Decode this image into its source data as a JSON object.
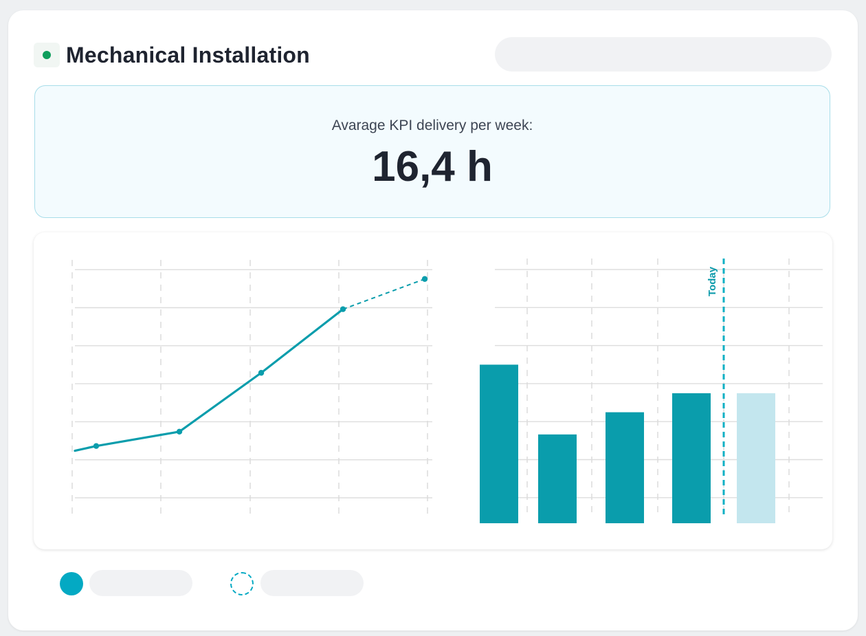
{
  "header": {
    "title": "Mechanical Installation",
    "status_color": "#0e9e5c"
  },
  "kpi": {
    "label": "Avarage KPI delivery per week:",
    "value": "16,4 h"
  },
  "colors": {
    "primary": "#0a9dac",
    "projected": "#c3e6ee",
    "grid": "#dddddd"
  },
  "chart_data": [
    {
      "type": "line",
      "x": [
        0,
        1,
        2,
        3,
        4
      ],
      "values": [
        3.3,
        4.2,
        7.9,
        11.9,
        13.8
      ],
      "projected_from_index": 3,
      "ylim": [
        0,
        15
      ],
      "grid": true
    },
    {
      "type": "bar",
      "categories": [
        "1",
        "2",
        "3",
        "4",
        "5"
      ],
      "values": [
        25,
        14,
        17.5,
        20.5,
        20.5
      ],
      "projected": [
        false,
        false,
        false,
        false,
        true
      ],
      "today_label": "Today",
      "today_after_index": 3,
      "ylim": [
        0,
        40
      ],
      "grid": true
    }
  ],
  "legend": [
    {
      "style": "solid",
      "icon": "filled-circle-icon"
    },
    {
      "style": "dashed",
      "icon": "dashed-circle-icon"
    }
  ]
}
